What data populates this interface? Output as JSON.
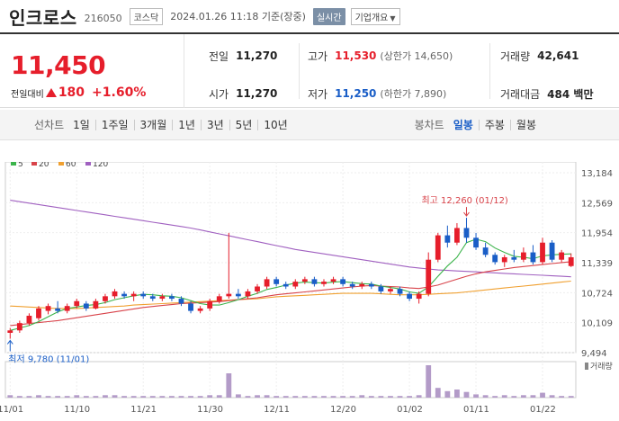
{
  "header": {
    "name": "인크로스",
    "code": "216050",
    "market": "코스닥",
    "datetime": "2024.01.26 11:18 기준(장중)",
    "realtime": "실시간",
    "company_info": "기업개요"
  },
  "quote": {
    "price": "11,450",
    "change_label": "전일대비",
    "change_value": "180",
    "change_pct": "+1.60%",
    "prev_close_label": "전일",
    "prev_close": "11,270",
    "open_label": "시가",
    "open": "11,270",
    "high_label": "고가",
    "high": "11,530",
    "high_limit": "(상한가 14,650)",
    "low_label": "저가",
    "low": "11,250",
    "low_limit": "(하한가 7,890)",
    "volume_label": "거래량",
    "volume": "42,641",
    "amount_label": "거래대금",
    "amount": "484 백만"
  },
  "tabs": {
    "line_label": "선차트",
    "periods": [
      "1일",
      "1주일",
      "3개월",
      "1년",
      "3년",
      "5년",
      "10년"
    ],
    "candle_label": "봉차트",
    "candle_periods": [
      "일봉",
      "주봉",
      "월봉"
    ],
    "active_candle": "일봉"
  },
  "colors": {
    "up": "#e61e2b",
    "down": "#1a5ec7",
    "ma5": "#3cb44b",
    "ma20": "#d8434a",
    "ma60": "#f0a030",
    "ma120": "#a060c0"
  },
  "chart_data": {
    "type": "candlestick",
    "legend": [
      {
        "name": "5",
        "color": "#3cb44b"
      },
      {
        "name": "20",
        "color": "#d8434a"
      },
      {
        "name": "60",
        "color": "#f0a030"
      },
      {
        "name": "120",
        "color": "#a060c0"
      }
    ],
    "y_ticks": [
      "13,184",
      "12,569",
      "11,954",
      "11,339",
      "10,724",
      "10,109",
      "9,494"
    ],
    "ylim": [
      9494,
      13184
    ],
    "x_ticks": [
      "11/01",
      "11/10",
      "11/21",
      "11/30",
      "12/11",
      "12/20",
      "01/02",
      "01/11",
      "01/22"
    ],
    "x_tick_index": [
      0,
      7,
      14,
      21,
      28,
      35,
      42,
      49,
      56
    ],
    "annotation_high": "최고 12,260 (01/12)",
    "annotation_low": "최저 9,780 (11/01)",
    "volume_label": "거래량",
    "candles": [
      [
        9900,
        10000,
        9780,
        9950
      ],
      [
        9950,
        10150,
        9900,
        10100
      ],
      [
        10100,
        10300,
        10050,
        10250
      ],
      [
        10200,
        10450,
        10150,
        10400
      ],
      [
        10350,
        10500,
        10280,
        10450
      ],
      [
        10400,
        10550,
        10300,
        10350
      ],
      [
        10350,
        10500,
        10300,
        10450
      ],
      [
        10450,
        10600,
        10400,
        10550
      ],
      [
        10500,
        10550,
        10350,
        10400
      ],
      [
        10400,
        10600,
        10380,
        10550
      ],
      [
        10550,
        10700,
        10500,
        10650
      ],
      [
        10650,
        10800,
        10600,
        10750
      ],
      [
        10700,
        10750,
        10600,
        10650
      ],
      [
        10650,
        10750,
        10550,
        10700
      ],
      [
        10700,
        10750,
        10600,
        10650
      ],
      [
        10650,
        10700,
        10550,
        10600
      ],
      [
        10600,
        10700,
        10550,
        10650
      ],
      [
        10650,
        10700,
        10550,
        10600
      ],
      [
        10600,
        10650,
        10450,
        10500
      ],
      [
        10500,
        10550,
        10300,
        10350
      ],
      [
        10350,
        10450,
        10300,
        10400
      ],
      [
        10400,
        10600,
        10350,
        10550
      ],
      [
        10550,
        10700,
        10500,
        10650
      ],
      [
        10650,
        11950,
        10600,
        10700
      ],
      [
        10700,
        10800,
        10600,
        10650
      ],
      [
        10650,
        10800,
        10600,
        10750
      ],
      [
        10750,
        10900,
        10700,
        10850
      ],
      [
        10850,
        11050,
        10800,
        11000
      ],
      [
        11000,
        11050,
        10850,
        10900
      ],
      [
        10900,
        10950,
        10800,
        10850
      ],
      [
        10850,
        11000,
        10800,
        10950
      ],
      [
        10950,
        11050,
        10900,
        11000
      ],
      [
        11000,
        11050,
        10850,
        10900
      ],
      [
        10900,
        11000,
        10850,
        10950
      ],
      [
        10950,
        11050,
        10900,
        11000
      ],
      [
        11000,
        11050,
        10850,
        10900
      ],
      [
        10900,
        10950,
        10800,
        10850
      ],
      [
        10850,
        10950,
        10800,
        10900
      ],
      [
        10900,
        10950,
        10800,
        10850
      ],
      [
        10850,
        10900,
        10700,
        10750
      ],
      [
        10750,
        10850,
        10700,
        10800
      ],
      [
        10800,
        10850,
        10650,
        10700
      ],
      [
        10700,
        10750,
        10550,
        10600
      ],
      [
        10600,
        10750,
        10500,
        10700
      ],
      [
        10700,
        11550,
        10650,
        11400
      ],
      [
        11400,
        11950,
        11350,
        11900
      ],
      [
        11900,
        12100,
        11650,
        11750
      ],
      [
        11750,
        12150,
        11700,
        12050
      ],
      [
        12050,
        12260,
        11750,
        11850
      ],
      [
        11850,
        11950,
        11600,
        11650
      ],
      [
        11650,
        11750,
        11450,
        11500
      ],
      [
        11500,
        11550,
        11300,
        11350
      ],
      [
        11350,
        11500,
        11250,
        11450
      ],
      [
        11450,
        11600,
        11350,
        11400
      ],
      [
        11400,
        11650,
        11350,
        11550
      ],
      [
        11550,
        11700,
        11300,
        11350
      ],
      [
        11350,
        11850,
        11300,
        11750
      ],
      [
        11750,
        11800,
        11350,
        11400
      ],
      [
        11400,
        11600,
        11350,
        11550
      ],
      [
        11270,
        11530,
        11250,
        11450
      ]
    ],
    "volume": [
      3,
      2,
      2,
      3,
      2,
      2,
      2,
      3,
      2,
      2,
      3,
      3,
      2,
      2,
      2,
      2,
      2,
      2,
      2,
      2,
      2,
      3,
      3,
      30,
      4,
      2,
      3,
      3,
      2,
      2,
      2,
      2,
      2,
      2,
      2,
      2,
      2,
      3,
      2,
      2,
      2,
      2,
      2,
      3,
      40,
      12,
      8,
      10,
      7,
      4,
      3,
      2,
      3,
      2,
      3,
      3,
      6,
      3,
      2,
      2
    ],
    "ma5": [
      9950,
      10000,
      10050,
      10130,
      10230,
      10330,
      10400,
      10430,
      10460,
      10480,
      10520,
      10580,
      10620,
      10660,
      10690,
      10680,
      10660,
      10650,
      10620,
      10560,
      10500,
      10470,
      10470,
      10520,
      10580,
      10650,
      10710,
      10790,
      10830,
      10880,
      10920,
      10940,
      10930,
      10920,
      10940,
      10950,
      10930,
      10910,
      10900,
      10860,
      10830,
      10800,
      10740,
      10710,
      10840,
      11060,
      11270,
      11450,
      11750,
      11820,
      11770,
      11640,
      11550,
      11470,
      11450,
      11420,
      11480,
      11500,
      11510,
      11520
    ],
    "ma20": [
      10050,
      10070,
      10090,
      10110,
      10130,
      10150,
      10180,
      10210,
      10240,
      10270,
      10300,
      10330,
      10360,
      10390,
      10420,
      10440,
      10460,
      10480,
      10500,
      10510,
      10520,
      10530,
      10540,
      10560,
      10580,
      10600,
      10620,
      10650,
      10680,
      10700,
      10720,
      10740,
      10760,
      10780,
      10800,
      10820,
      10840,
      10860,
      10870,
      10860,
      10850,
      10840,
      10820,
      10810,
      10840,
      10880,
      10940,
      11000,
      11060,
      11110,
      11150,
      11180,
      11210,
      11240,
      11260,
      11280,
      11300,
      11320,
      11340,
      11360
    ],
    "ma60": [
      10450,
      10440,
      10430,
      10420,
      10410,
      10400,
      10400,
      10400,
      10410,
      10420,
      10430,
      10440,
      10450,
      10470,
      10480,
      10490,
      10500,
      10510,
      10520,
      10530,
      10540,
      10550,
      10560,
      10570,
      10580,
      10590,
      10600,
      10620,
      10640,
      10650,
      10660,
      10670,
      10680,
      10690,
      10700,
      10710,
      10710,
      10710,
      10710,
      10700,
      10690,
      10680,
      10680,
      10680,
      10690,
      10700,
      10710,
      10720,
      10740,
      10760,
      10780,
      10800,
      10820,
      10840,
      10860,
      10880,
      10900,
      10920,
      10940,
      10960
    ],
    "ma120": [
      12620,
      12590,
      12560,
      12530,
      12500,
      12470,
      12440,
      12410,
      12380,
      12350,
      12320,
      12290,
      12260,
      12230,
      12200,
      12170,
      12140,
      12110,
      12080,
      12050,
      12010,
      11970,
      11930,
      11890,
      11850,
      11810,
      11770,
      11730,
      11690,
      11650,
      11610,
      11580,
      11550,
      11520,
      11490,
      11460,
      11430,
      11400,
      11370,
      11340,
      11310,
      11280,
      11250,
      11230,
      11210,
      11190,
      11180,
      11170,
      11160,
      11150,
      11140,
      11130,
      11120,
      11110,
      11100,
      11090,
      11080,
      11070,
      11060,
      11050
    ]
  }
}
